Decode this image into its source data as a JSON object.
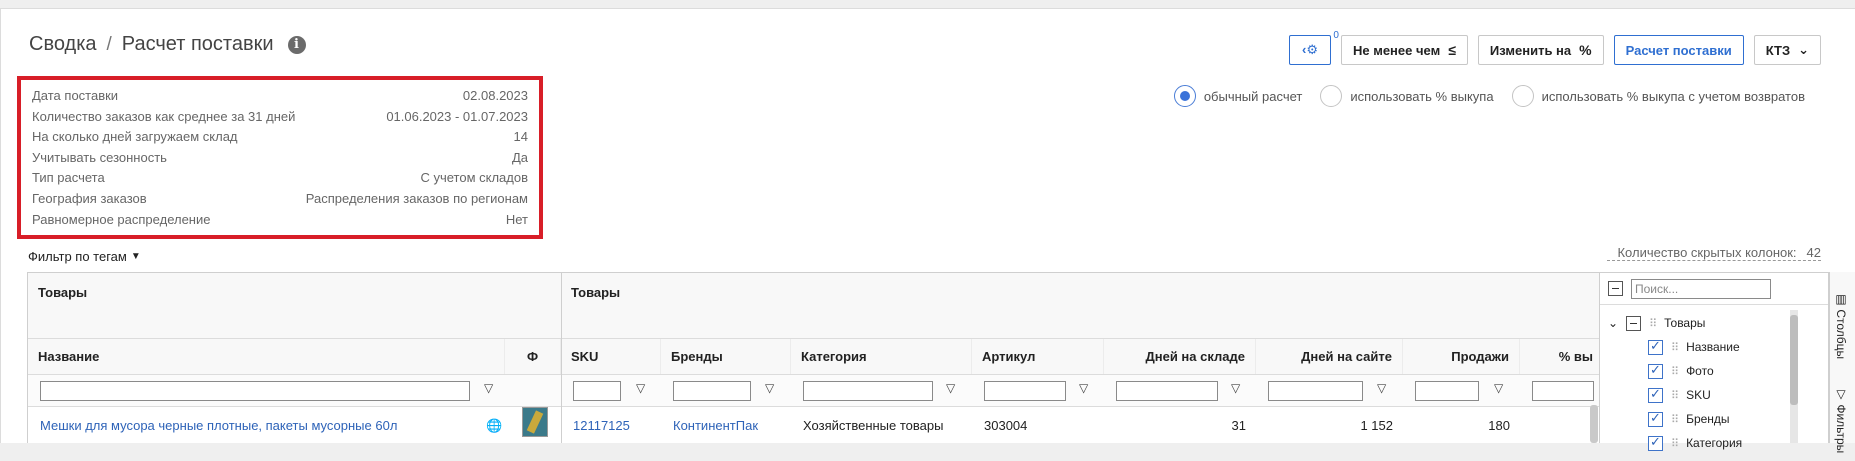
{
  "breadcrumb": {
    "root": "Сводка",
    "separator": "/",
    "current": "Расчет поставки"
  },
  "summary": [
    {
      "label": "Дата поставки",
      "value": "02.08.2023"
    },
    {
      "label": "Количество заказов как среднее за 31 дней",
      "value": "01.06.2023 - 01.07.2023"
    },
    {
      "label": "На сколько дней загружаем склад",
      "value": "14"
    },
    {
      "label": "Учитывать сезонность",
      "value": "Да"
    },
    {
      "label": "Тип расчета",
      "value": "С учетом складов"
    },
    {
      "label": "География заказов",
      "value": "Распределения заказов по регионам"
    },
    {
      "label": "Равномерное распределение",
      "value": "Нет"
    }
  ],
  "toolbar": {
    "settings_badge": "0",
    "not_less_label": "Не менее чем",
    "not_less_symbol": "≤",
    "change_label": "Изменить на",
    "change_symbol": "%",
    "calc_label": "Расчет поставки",
    "kt3_label": "КТЗ"
  },
  "calc_mode": {
    "selected": "обычный расчет",
    "options": [
      "обычный расчет",
      "использовать % выкупа",
      "использовать % выкупа с учетом возвратов"
    ]
  },
  "filters": {
    "tag_filter_label": "Фильтр по тегам",
    "hidden_columns_label": "Количество скрытых колонок:",
    "hidden_columns_count": "42"
  },
  "grid": {
    "groups": [
      "Товары",
      "Товары"
    ],
    "columns": [
      "Название",
      "Ф",
      "SKU",
      "Бренды",
      "Категория",
      "Артикул",
      "Дней на складе",
      "Дней на сайте",
      "Продажи",
      "% вы"
    ],
    "rows": [
      {
        "name": "Мешки для мусора черные плотные, пакеты мусорные 60л",
        "sku": "12117125",
        "brand": "КонтинентПак",
        "category": "Хозяйственные товары",
        "article": "303004",
        "days_stock": "31",
        "days_site": "1 152",
        "sales": "180"
      }
    ]
  },
  "column_panel": {
    "search_placeholder": "Поиск...",
    "group_label": "Товары",
    "items": [
      "Название",
      "Фото",
      "SKU",
      "Бренды",
      "Категория"
    ],
    "tab_columns": "Столбцы",
    "tab_filters": "Фильтры"
  }
}
